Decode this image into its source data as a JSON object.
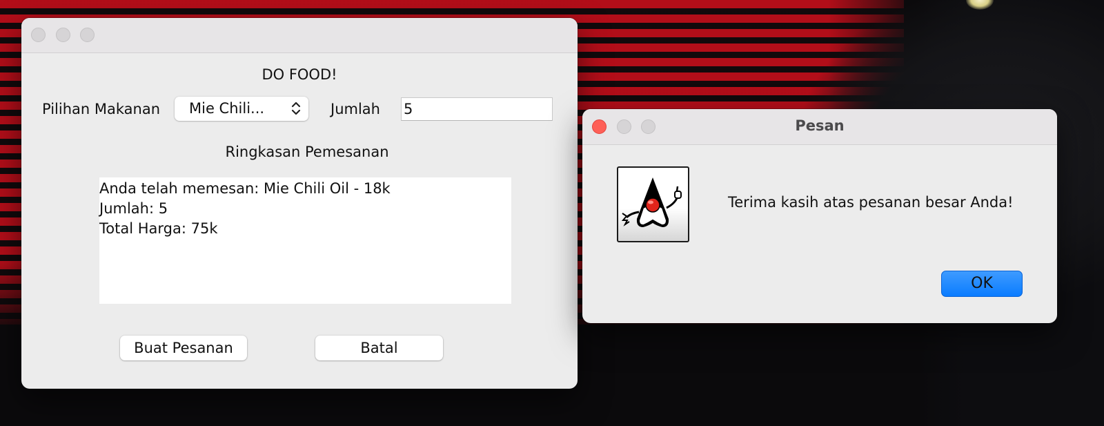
{
  "main_window": {
    "heading": "DO FOOD!",
    "food_label": "Pilihan Makanan",
    "food_selected": "Mie Chili...",
    "quantity_label": "Jumlah",
    "quantity_value": "5",
    "summary_heading": "Ringkasan Pemesanan",
    "summary_lines": [
      "Anda telah memesan: Mie Chili Oil - 18k",
      "Jumlah: 5",
      "Total Harga: 75k"
    ],
    "order_button": "Buat Pesanan",
    "cancel_button": "Batal"
  },
  "dialog": {
    "title": "Pesan",
    "message": "Terima kasih atas pesanan besar Anda!",
    "ok_button": "OK",
    "icon": "java-duke-icon"
  },
  "colors": {
    "close_button": "#fe5f57",
    "accent_button": "#0a7cff",
    "wallpaper_stripes": "#c10e1a"
  }
}
